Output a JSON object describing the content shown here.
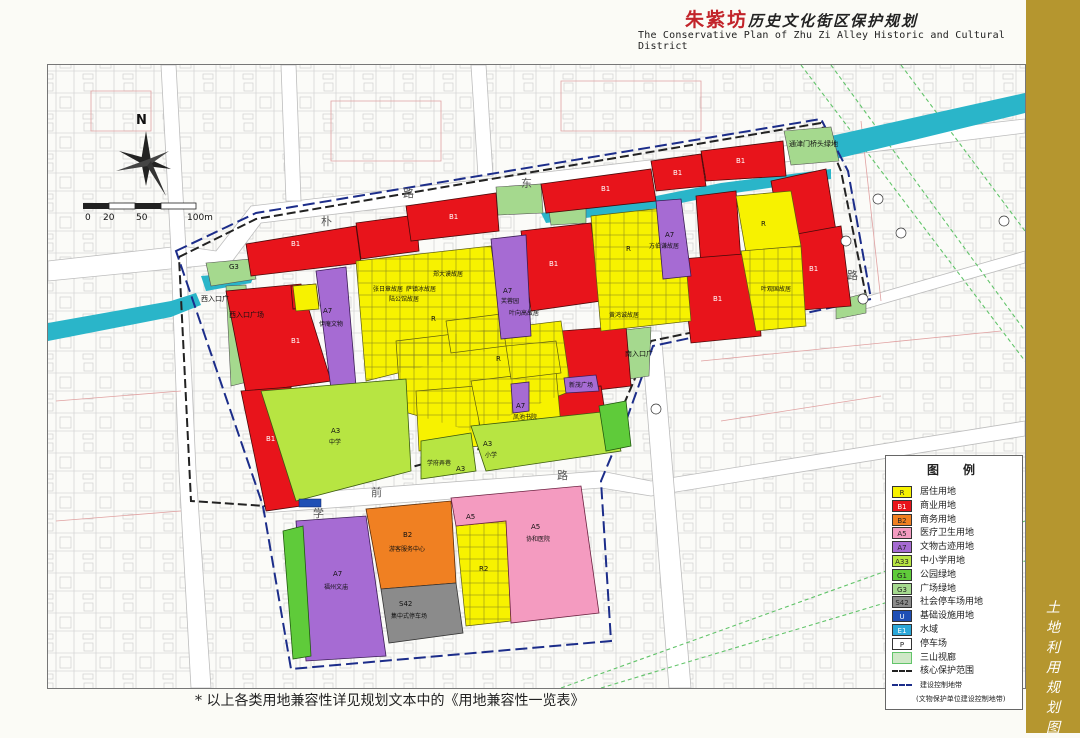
{
  "title": {
    "cn_red": "朱紫坊",
    "cn_rest": "历史文化街区保护规划",
    "en": "The Conservative Plan of Zhu Zi Alley Historic and Cultural District"
  },
  "side_title": "土地利用规划图",
  "scale": {
    "north": "N",
    "ticks": [
      "0",
      "20",
      "50",
      "100m"
    ]
  },
  "places": {
    "west_gate": "西入口广场",
    "west_gate2": "西入口广",
    "northeast_gate": "通津门桥头绿地",
    "south_gate": "南入口广",
    "a7_yishu": "伊庵文物",
    "a7_zhangri": "张日章故居",
    "a7_lu": "陆公馆故居",
    "a7_sa": "萨镇冰故居",
    "a7_zheng": "郑大谟故居",
    "a7_furong": "芙蓉园",
    "a7_yexiang": "叶向高故居",
    "a7_fangshou": "方伯谦故居",
    "a7_yeguan": "叶观国故居",
    "a7_huang": "黄鸿诚故居",
    "a7_fengzhu": "凤池书院",
    "a7_ling": "新茂广场",
    "a7_fuzhou": "福州文庙",
    "a33_zhongxue": "中学",
    "a33_xiaoxue": "小学",
    "a33_fuzhu": "学府弄巷",
    "b2_center": "游客服务中心",
    "s42": "集中式停车场",
    "a5": "协和医院",
    "street_n1": "路",
    "street_n2": "东",
    "street_n3": "朴",
    "street_s": "路",
    "street_s2": "前",
    "street_s3": "学",
    "street_e": "路"
  },
  "codes": {
    "R": "R",
    "B1": "B1",
    "B2": "B2",
    "R2": "R2",
    "A5": "A5",
    "A7": "A7",
    "A3": "A3",
    "G3": "G3",
    "S42": "S42"
  },
  "legend": {
    "title": "图　例",
    "items": [
      {
        "code": "R",
        "label": "居住用地",
        "color": "#f7f200"
      },
      {
        "code": "B1",
        "label": "商业用地",
        "color": "#e8141b"
      },
      {
        "code": "B2",
        "label": "商务用地",
        "color": "#f08022"
      },
      {
        "code": "A5",
        "label": "医疗卫生用地",
        "color": "#f49bc0"
      },
      {
        "code": "A7",
        "label": "文物古迹用地",
        "color": "#a66bd3"
      },
      {
        "code": "A33",
        "label": "中小学用地",
        "color": "#b7e542"
      },
      {
        "code": "G1",
        "label": "公园绿地",
        "color": "#5fcb3a"
      },
      {
        "code": "G3",
        "label": "广场绿地",
        "color": "#a5d98e"
      },
      {
        "code": "S42",
        "label": "社会停车场用地",
        "color": "#8b8b8b"
      },
      {
        "code": "U",
        "label": "基础设施用地",
        "color": "#1f4fb5"
      },
      {
        "code": "E1",
        "label": "水域",
        "color": "#2aa7d8"
      },
      {
        "code": "P",
        "label": "停车场",
        "color": "#ffffff"
      },
      {
        "code": "",
        "label": "三山视廊",
        "color": "#cfe8c7"
      },
      {
        "code": "",
        "label": "核心保护范围",
        "color": "#ffffff"
      },
      {
        "code": "",
        "label": "建设控制地带",
        "color": "#ffffff"
      },
      {
        "code": "",
        "label": "(文物保护单位建设控制地带)",
        "color": "#ffffff"
      }
    ]
  },
  "footnote": "* 以上各类用地兼容性详见规划文本中的《用地兼容性一览表》"
}
